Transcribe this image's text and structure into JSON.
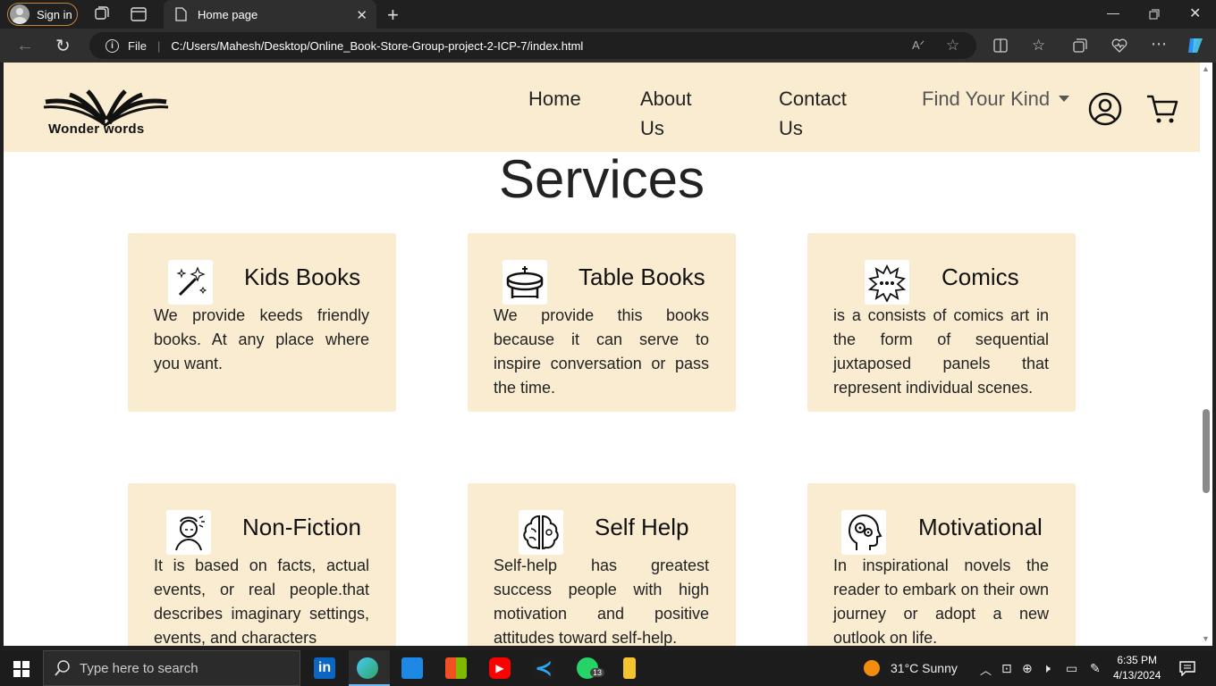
{
  "browser": {
    "sign_in": "Sign in",
    "tab_title": "Home page",
    "address_scheme": "File",
    "url": "C:/Users/Mahesh/Desktop/Online_Book-Store-Group-project-2-ICP-7/index.html"
  },
  "site": {
    "logo_text": "Wonder words",
    "nav": {
      "home": "Home",
      "about_line1": "About",
      "about_line2": "Us",
      "contact_line1": "Contact",
      "contact_line2": "Us",
      "find_kind": "Find Your Kind"
    },
    "section_title": "Services",
    "cards": [
      {
        "title": "Kids Books",
        "icon": "magic-wand-icon",
        "desc": "We provide keeds friendly books. At any place where you want."
      },
      {
        "title": "Table Books",
        "icon": "table-icon",
        "desc": "We provide this books because it can serve to inspire conversation or pass the time."
      },
      {
        "title": "Comics",
        "icon": "speech-burst-icon",
        "desc": "is a consists of comics art in the form of sequential juxtaposed panels that represent individual scenes."
      },
      {
        "title": "Non-Fiction",
        "icon": "thinking-person-icon",
        "desc": "It is based on facts, actual events, or real people.that describes imaginary settings, events, and characters"
      },
      {
        "title": "Self Help",
        "icon": "brain-icon",
        "desc": "Self-help has greatest success people with high motivation and positive attitudes toward self-help."
      },
      {
        "title": "Motivational",
        "icon": "head-gears-icon",
        "desc": "In inspirational novels the reader to embark on their own journey or adopt a new outlook on life."
      }
    ]
  },
  "taskbar": {
    "search_placeholder": "Type here to search",
    "weather": "31°C  Sunny",
    "whatsapp_badge": "13",
    "time": "6:35 PM",
    "date": "4/13/2024"
  }
}
